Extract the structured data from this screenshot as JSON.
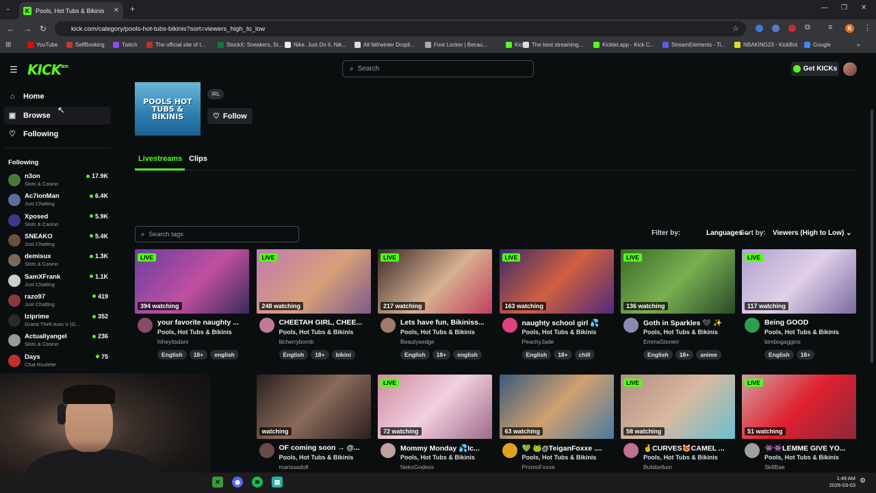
{
  "browser": {
    "tab_title": "Pools, Hot Tubs & Bikinis St",
    "tab_favicon": "K",
    "url": "kick.com/category/pools-hot-tubs-bikinis?sort=viewers_high_to_low",
    "bookmarks": [
      {
        "label": "YouTube",
        "color": "#ff0000"
      },
      {
        "label": "SelfBooking",
        "color": "#cc3333"
      },
      {
        "label": "Twitch",
        "color": "#9146ff"
      },
      {
        "label": "The official site of t...",
        "color": "#b33"
      },
      {
        "label": "StockX: Sneakers, St...",
        "color": "#0a7d3b"
      },
      {
        "label": "Nike. Just Do It. Nik...",
        "color": "#eee"
      },
      {
        "label": "All fall/winter Dropli...",
        "color": "#ddd"
      },
      {
        "label": "Foot Locker | Becau...",
        "color": "#aaa"
      },
      {
        "label": "Kick",
        "color": "#53fc18"
      },
      {
        "label": "The best streaming...",
        "color": "#ddd"
      },
      {
        "label": "Kicklet.app - Kick C...",
        "color": "#53fc18"
      },
      {
        "label": "StreamElements - Ti...",
        "color": "#5b5bf0"
      },
      {
        "label": "NBAKING23 - KickBot",
        "color": "#e0e020"
      },
      {
        "label": "Google",
        "color": "#4285f4"
      }
    ]
  },
  "header": {
    "logo": "KICK",
    "logo_beta": "BETA",
    "search_placeholder": "Search",
    "get_kicks": "Get KICKs"
  },
  "sidebar": {
    "nav": [
      {
        "label": "Home",
        "icon": "home-icon",
        "glyph": "⌂"
      },
      {
        "label": "Browse",
        "icon": "browse-icon",
        "glyph": "▣"
      },
      {
        "label": "Following",
        "icon": "heart-icon",
        "glyph": "♡"
      }
    ],
    "following_title": "Following",
    "following": [
      {
        "name": "n3on",
        "category": "Slots & Casino",
        "viewers": "17.9K",
        "color": "#4a7a3a"
      },
      {
        "name": "Ac7ionMan",
        "category": "Just Chatting",
        "viewers": "6.4K",
        "color": "#5a6ea0"
      },
      {
        "name": "Xposed",
        "category": "Slots & Casino",
        "viewers": "5.9K",
        "color": "#3a3a8a"
      },
      {
        "name": "SNEAKO",
        "category": "Just Chatting",
        "viewers": "5.4K",
        "color": "#6b5040"
      },
      {
        "name": "demisux",
        "category": "Slots & Casino",
        "viewers": "1.3K",
        "color": "#7a6a5a"
      },
      {
        "name": "SamXFrank",
        "category": "Just Chatting",
        "viewers": "1.1K",
        "color": "#cfcfcf"
      },
      {
        "name": "razo97",
        "category": "Just Chatting",
        "viewers": "419",
        "color": "#8a3a3a"
      },
      {
        "name": "Iziprime",
        "category": "Grand Theft Auto V (G...",
        "viewers": "352",
        "color": "#2a2a2a"
      },
      {
        "name": "Actuallyangel",
        "category": "Slots & Casino",
        "viewers": "236",
        "color": "#9a9a9a"
      },
      {
        "name": "Days",
        "category": "Chat Roulette",
        "viewers": "75",
        "color": "#c03030"
      }
    ]
  },
  "category": {
    "thumb_text": "POOLS HOT TUBS & BIKINIS",
    "tag": "IRL",
    "follow_label": "Follow",
    "tabs": [
      "Livestreams",
      "Clips"
    ],
    "search_tags_placeholder": "Search tags",
    "filter_by": "Filter by:",
    "languages": "Languages",
    "sort_by": "Sort by:",
    "sort_value": "Viewers (High to Low)"
  },
  "streams_row1": [
    {
      "live": "LIVE",
      "watching": "394 watching",
      "title": "your favorite naughty ...",
      "category": "Pools, Hot Tubs & Bikinis",
      "user": "hiheyitsdani",
      "tags": [
        "English",
        "18+",
        "english"
      ],
      "bg": "linear-gradient(135deg,#6a3fa0,#c050a0 55%,#3a2a5a)",
      "av": "#8a4a6a"
    },
    {
      "live": "LIVE",
      "watching": "248 watching",
      "title": "CHEETAH GIRL, CHEE...",
      "category": "Pools, Hot Tubs & Bikinis",
      "user": "lilcherrybomb",
      "tags": [
        "English",
        "18+",
        "bikini"
      ],
      "bg": "linear-gradient(135deg,#c07ab0,#d9a07a 55%,#7a5a8a)",
      "av": "#c07a9a"
    },
    {
      "live": "LIVE",
      "watching": "217 watching",
      "title": "Lets have fun, Bikiniss...",
      "category": "Pools, Hot Tubs & Bikinis",
      "user": "Beautysedge",
      "tags": [
        "English",
        "18+",
        "english"
      ],
      "bg": "linear-gradient(135deg,#3a2a2a,#d8b090 55%,#c04060)",
      "av": "#a07a6a"
    },
    {
      "live": "LIVE",
      "watching": "163 watching",
      "title": "naughty school girl 💦",
      "category": "Pools, Hot Tubs & Bikinis",
      "user": "PeachyJade",
      "tags": [
        "English",
        "18+",
        "chill"
      ],
      "bg": "linear-gradient(135deg,#3a2a6a,#d06040 50%,#502a7a)",
      "av": "#e04080"
    },
    {
      "live": "LIVE",
      "watching": "136 watching",
      "title": "Goth in Sparkles 🖤 ✨",
      "category": "Pools, Hot Tubs & Bikinis",
      "user": "EmmaStonerr",
      "tags": [
        "English",
        "18+",
        "anime"
      ],
      "bg": "linear-gradient(135deg,#3a6a2a,#7ab050 50%,#2a4a2a)",
      "av": "#8a8ab0"
    },
    {
      "live": "LIVE",
      "watching": "117 watching",
      "title": "Being GOOD",
      "category": "Pools, Hot Tubs & Bikinis",
      "user": "bimbogaggins",
      "tags": [
        "English",
        "18+"
      ],
      "bg": "linear-gradient(135deg,#b0a0d0,#e0d0e8 50%,#7a6aa0)",
      "av": "#2aa050"
    }
  ],
  "streams_row2": [
    {
      "live": "",
      "watching": "watching",
      "title": "OF coming soon → @...",
      "category": "Pools, Hot Tubs & Bikinis",
      "user": "marissadoll",
      "bg": "linear-gradient(135deg,#2a2020,#8a6a5a 50%,#2a2020)",
      "av": "#6a4a4a"
    },
    {
      "live": "LIVE",
      "watching": "72 watching",
      "title": "Mommy Monday 💦Ic...",
      "category": "Pools, Hot Tubs & Bikinis",
      "user": "NekoGodess",
      "bg": "linear-gradient(135deg,#d08aa0,#f0d0e0 50%,#a06a8a)",
      "av": "#c0a0a0"
    },
    {
      "live": "",
      "watching": "63 watching",
      "title": "💚 🐸@TeiganFoxxe ....",
      "category": "Pools, Hot Tubs & Bikinis",
      "user": "PromoFoxxe",
      "bg": "linear-gradient(135deg,#3a5a7a,#d0a070 50%,#4a7aa0)",
      "av": "#e0a020"
    },
    {
      "live": "LIVE",
      "watching": "58 watching",
      "title": "🤞CURVES😻CAMEL ...",
      "category": "Pools, Hot Tubs & Bikinis",
      "user": "Bubibellum",
      "bg": "linear-gradient(135deg,#b09080,#d8b8a0 50%,#6ac0d0)",
      "av": "#c07090"
    },
    {
      "live": "LIVE",
      "watching": "51 watching",
      "title": "👾👾LEMME GIVE YO...",
      "category": "Pools, Hot Tubs & Bikinis",
      "user": "Sk8Bae",
      "bg": "linear-gradient(135deg,#d0a0a0,#e02030 50%,#8a2a3a)",
      "av": "#a0a0a0"
    }
  ],
  "taskbar": {
    "time": "1:49 AM",
    "date": "2026-03-03"
  }
}
